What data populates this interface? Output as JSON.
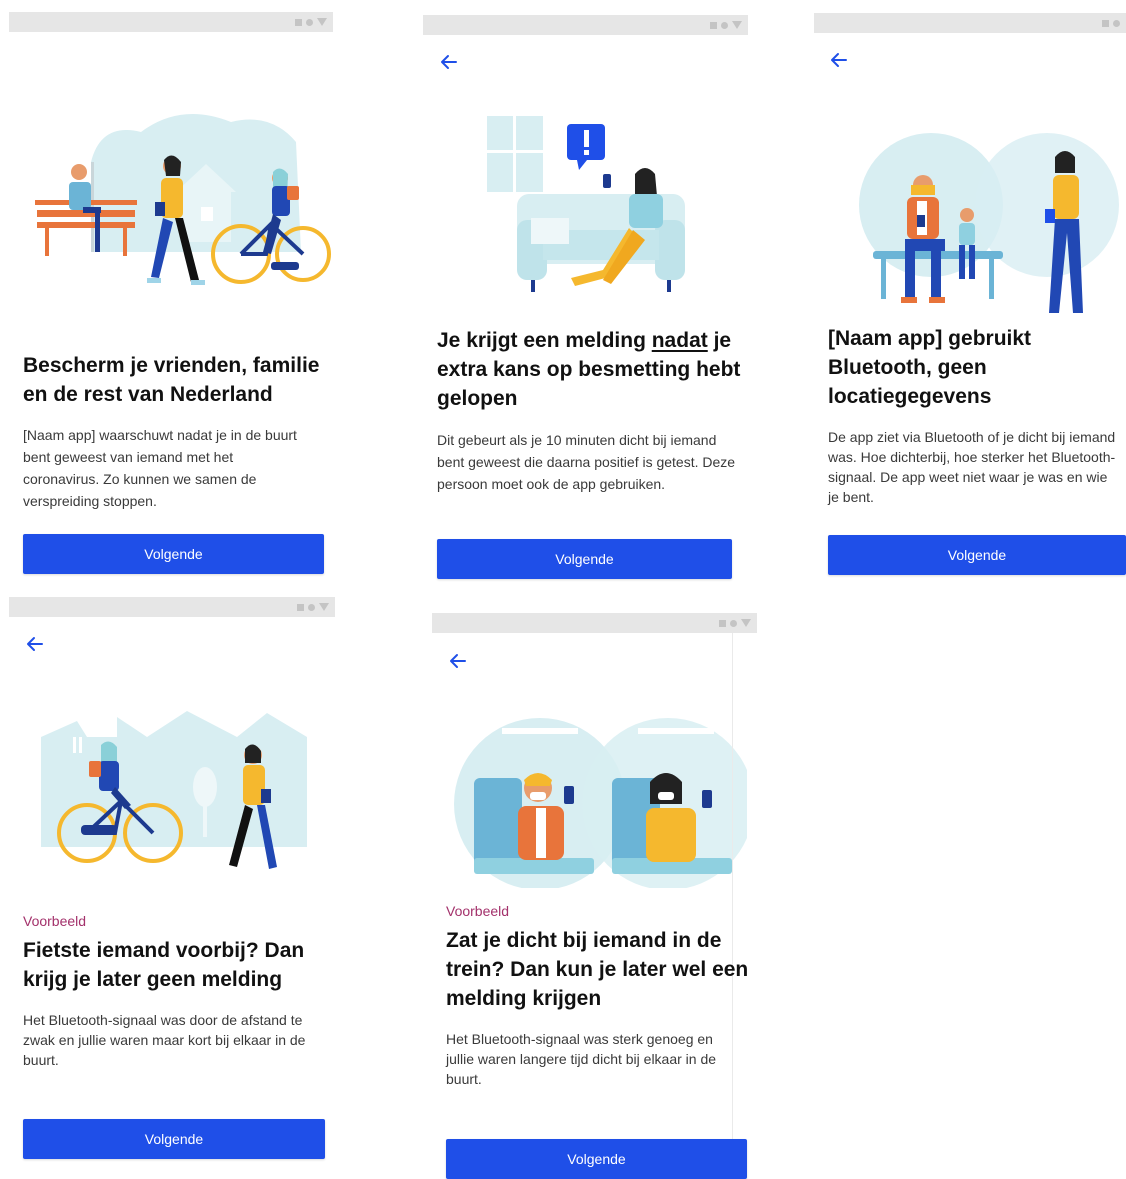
{
  "colors": {
    "primary": "#1f4fe8",
    "eyebrow": "#a3316b",
    "illustration_bg": "#d8eef2",
    "accent_yellow": "#f5b82e",
    "accent_orange": "#e8743b",
    "accent_navy": "#1d3a8f"
  },
  "screens": [
    {
      "title": "Bescherm je vrienden, familie en de rest van Nederland",
      "body": "[Naam app] waarschuwt nadat je in de buurt bent geweest van iemand met het coronavirus. Zo kunnen we samen de verspreiding stoppen.",
      "button": "Volgende",
      "has_back": false,
      "illustration": "people-walking-cycling-park"
    },
    {
      "title_before": "Je krijgt een melding ",
      "title_underlined": "nadat",
      "title_after": " je extra kans op besmetting hebt gelopen",
      "body": "Dit gebeurt als je 10 minuten dicht bij iemand bent geweest die daarna positief is getest. Deze persoon moet ook de app gebruiken.",
      "button": "Volgende",
      "has_back": true,
      "illustration": "woman-on-sofa-notification"
    },
    {
      "title": "[Naam app] gebruikt Bluetooth, geen locatiegegevens",
      "body": "De app ziet via Bluetooth of je dicht bij iemand was. Hoe dichterbij, hoe sterker het Bluetooth-signaal. De app weet niet waar je was en wie je bent.",
      "button": "Volgende",
      "has_back": true,
      "illustration": "bluetooth-proximity-circles"
    },
    {
      "eyebrow": "Voorbeeld",
      "title": "Fietste iemand voorbij? Dan krijg je later geen melding",
      "body": "Het Bluetooth-signaal was door de afstand te zwak en jullie waren maar kort bij elkaar in de buurt.",
      "button": "Volgende",
      "has_back": true,
      "illustration": "cyclist-passing-pedestrian"
    },
    {
      "eyebrow": "Voorbeeld",
      "title": "Zat je dicht bij iemand in de trein? Dan kun je later wel een melding krijgen",
      "body": "Het Bluetooth-signaal was sterk genoeg en jullie waren langere tijd dicht bij elkaar in de buurt.",
      "button": "Volgende",
      "has_back": true,
      "illustration": "two-people-in-train"
    }
  ]
}
